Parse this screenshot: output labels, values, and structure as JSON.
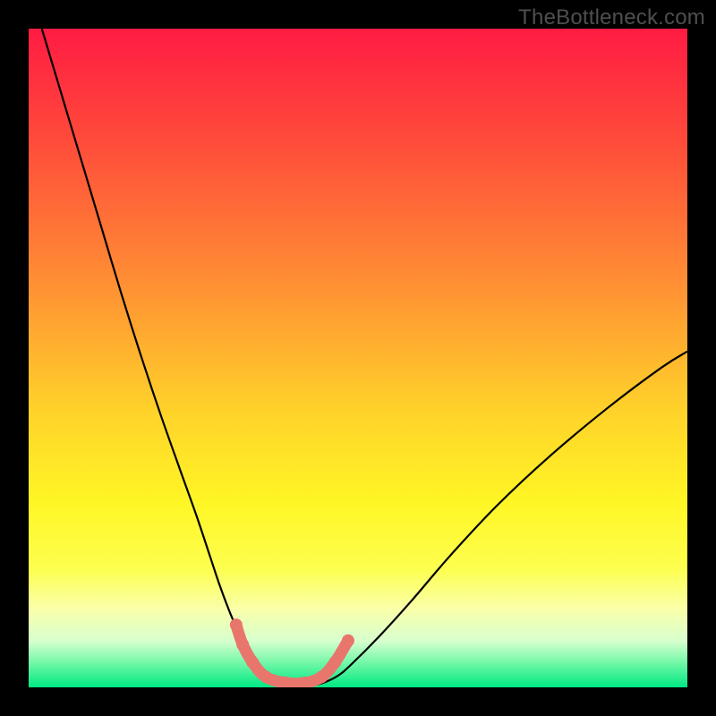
{
  "watermark": "TheBottleneck.com",
  "chart_data": {
    "type": "line",
    "title": "",
    "xlabel": "",
    "ylabel": "",
    "xlim": [
      0,
      100
    ],
    "ylim": [
      0,
      100
    ],
    "background_gradient": {
      "stops": [
        {
          "offset": 0.0,
          "color": "#ff1b43"
        },
        {
          "offset": 0.18,
          "color": "#ff4e3a"
        },
        {
          "offset": 0.38,
          "color": "#ff8d34"
        },
        {
          "offset": 0.58,
          "color": "#ffd22a"
        },
        {
          "offset": 0.72,
          "color": "#fff625"
        },
        {
          "offset": 0.82,
          "color": "#fdff4f"
        },
        {
          "offset": 0.88,
          "color": "#faffa8"
        },
        {
          "offset": 0.93,
          "color": "#d7ffcf"
        },
        {
          "offset": 0.965,
          "color": "#6bf7a5"
        },
        {
          "offset": 1.0,
          "color": "#00e884"
        }
      ]
    },
    "series": [
      {
        "name": "bottleneck-curve",
        "stroke": "#000000",
        "stroke_width": 2.2,
        "x": [
          2,
          5,
          8,
          11,
          14,
          17,
          20,
          23,
          25.5,
          27.5,
          29,
          30.5,
          32,
          33,
          34,
          35.5,
          37.5,
          40,
          43,
          45,
          47,
          49,
          53,
          58,
          64,
          71,
          79,
          88,
          96,
          100
        ],
        "y": [
          100,
          90,
          80,
          70,
          60,
          50.5,
          41.5,
          33,
          26,
          20,
          15.5,
          11.5,
          8,
          5.5,
          3.5,
          1.8,
          0.8,
          0.3,
          0.3,
          0.8,
          1.8,
          3.5,
          7.5,
          13,
          20,
          27.5,
          35,
          42.5,
          48.5,
          51
        ]
      },
      {
        "name": "bottom-marker-outline",
        "stroke": "#e8766d",
        "stroke_width": 13,
        "linecap": "round",
        "x": [
          31.5,
          32.5,
          34,
          36,
          39,
          42,
          44.5,
          46.5,
          48.5
        ],
        "y": [
          9.5,
          6.5,
          3.8,
          1.6,
          0.7,
          0.7,
          1.6,
          3.8,
          7.1
        ]
      }
    ],
    "marker_points": {
      "name": "bottom-marker-dots",
      "fill": "#e8766d",
      "r": 7,
      "x": [
        31.5,
        32.5,
        34,
        36,
        39,
        42,
        44.5,
        46.5,
        48.5
      ],
      "y": [
        9.5,
        6.5,
        3.8,
        1.6,
        0.7,
        0.7,
        1.6,
        3.8,
        7.1
      ]
    }
  }
}
